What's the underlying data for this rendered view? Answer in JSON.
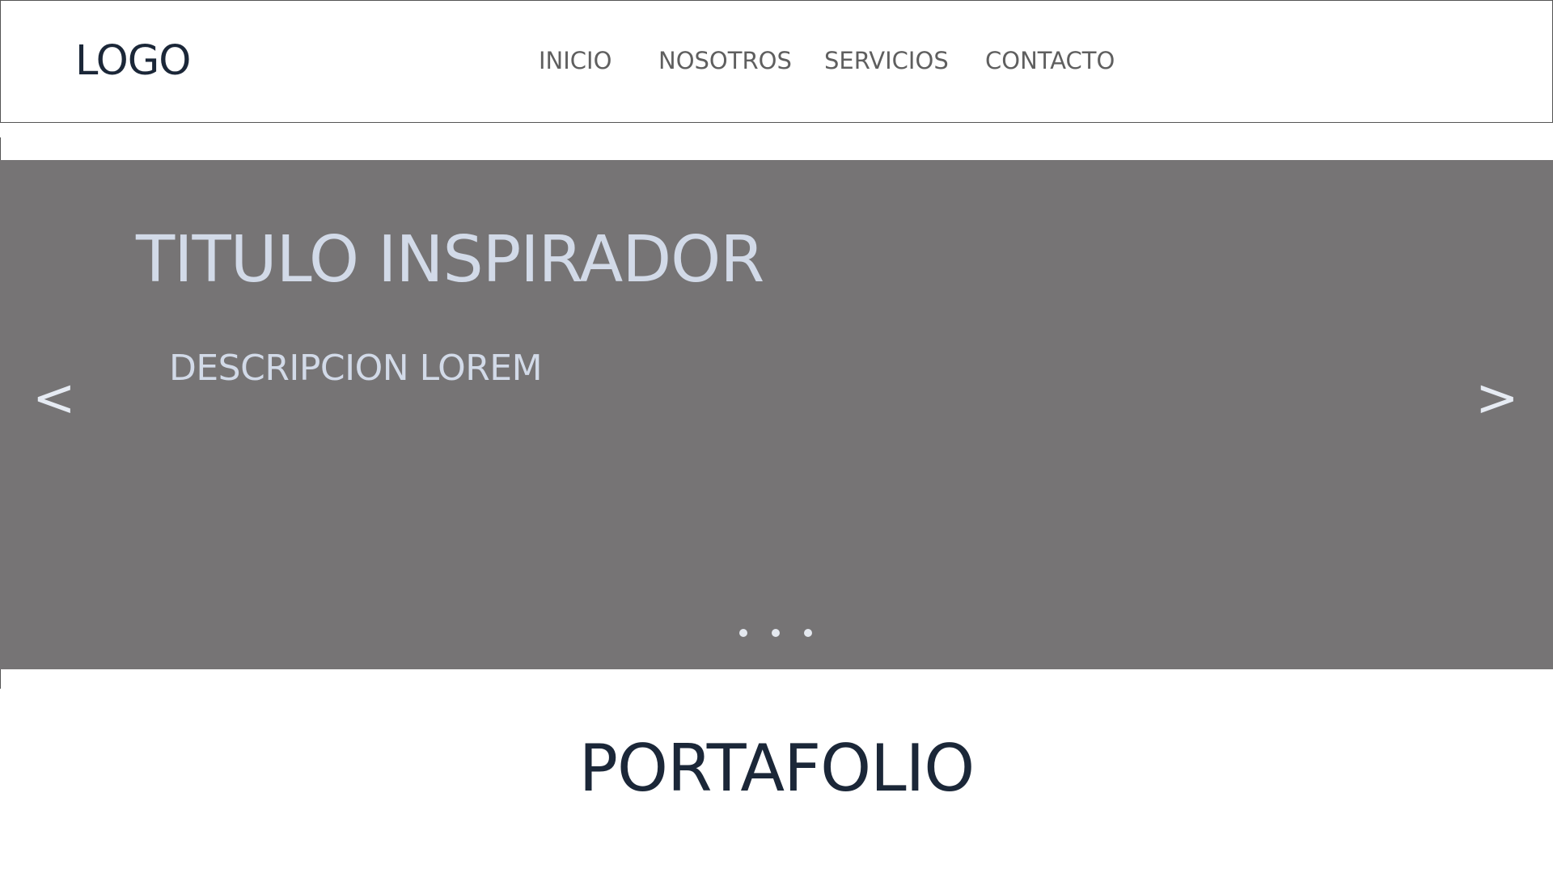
{
  "header": {
    "logo": "LOGO",
    "nav": [
      {
        "label": "INICIO"
      },
      {
        "label": "NOSOTROS"
      },
      {
        "label": "SERVICIOS"
      },
      {
        "label": "CONTACTO"
      }
    ]
  },
  "hero": {
    "title": "TITULO INSPIRADOR",
    "description": "DESCRIPCION LOREM",
    "prev_label": "<",
    "next_label": ">",
    "slide_count": 3
  },
  "portfolio": {
    "title": "PORTAFOLIO"
  },
  "colors": {
    "hero_background": "#767475",
    "hero_text": "#d2dae8",
    "heading_text": "#1b2738",
    "nav_text": "#5f5f5f"
  }
}
